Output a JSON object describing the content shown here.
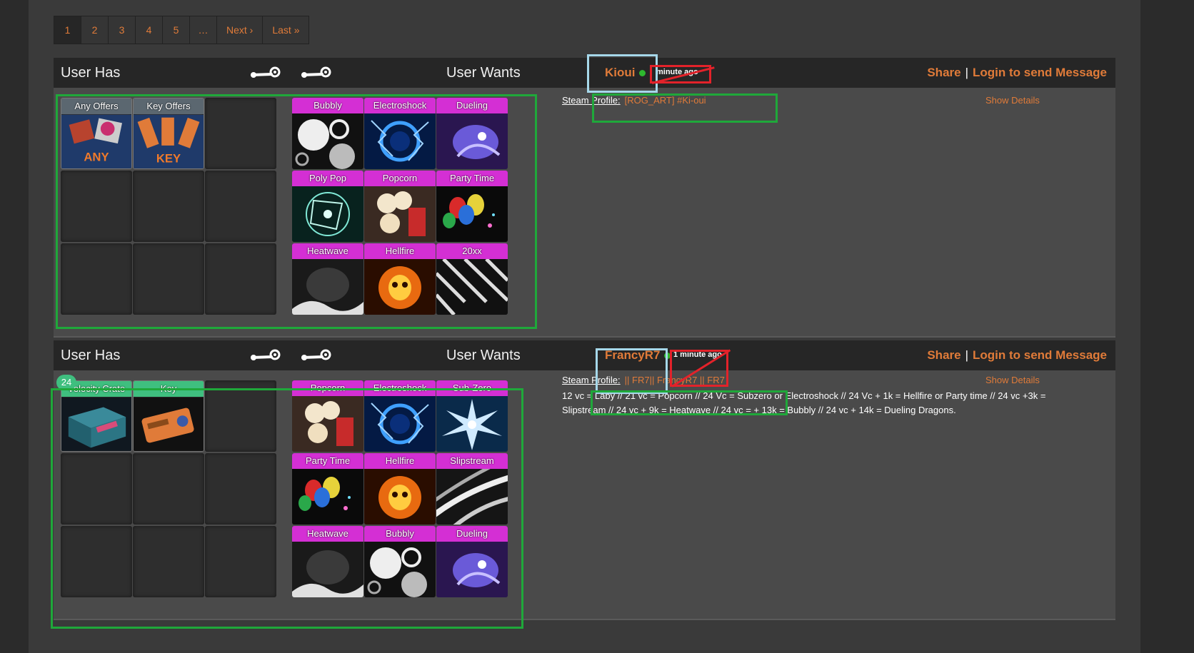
{
  "pagination": {
    "pages": [
      "1",
      "2",
      "3",
      "4",
      "5",
      "…"
    ],
    "next": "Next ›",
    "last": "Last »"
  },
  "trades": [
    {
      "has_label": "User Has",
      "wants_label": "User Wants",
      "username": "Kioui",
      "time_ago": "minute ago",
      "share": "Share",
      "separator": "|",
      "message": "Login to send Message",
      "steam_profile_label": "Steam Profile:",
      "steam_profile_value": "[ROG_ART] #Ki-oui",
      "show_details": "Show Details",
      "description": "",
      "has_items": [
        "Any Offers",
        "Key Offers"
      ],
      "wants_items": [
        "Bubbly",
        "Electroshock",
        "Dueling",
        "Poly Pop",
        "Popcorn",
        "Party Time",
        "Heatwave",
        "Hellfire",
        "20xx"
      ]
    },
    {
      "has_label": "User Has",
      "wants_label": "User Wants",
      "username": "FrancyR7",
      "time_ago": "1 minute ago",
      "share": "Share",
      "separator": "|",
      "message": "Login to send Message",
      "steam_profile_label": "Steam Profile:",
      "steam_profile_value": "|| FR7|| FrancyR7 || FR7",
      "show_details": "Show Details",
      "description": "12 vc = Laby // 21 vc = Popcorn // 24 Vc = Subzero or Electroshock // 24 Vc + 1k = Hellfire or Party time // 24 vc +3k = Slipstream // 24 vc + 9k = Heatwave // 24 vc = + 13k = Bubbly // 24 vc + 14k = Dueling Dragons.",
      "badge": "24",
      "has_items": [
        "Velocity Crate",
        "Key"
      ],
      "wants_items": [
        "Popcorn",
        "Electroshock",
        "Sub-Zero",
        "Party Time",
        "Hellfire",
        "Slipstream",
        "Heatwave",
        "Bubbly",
        "Dueling"
      ]
    }
  ],
  "colors": {
    "accent": "#e07b39",
    "item_header_pink": "#d42fd4",
    "online": "#2eb82e",
    "annotation_green": "#1fa83a",
    "annotation_blue": "#a6d8ea",
    "annotation_red": "#e3222a"
  }
}
